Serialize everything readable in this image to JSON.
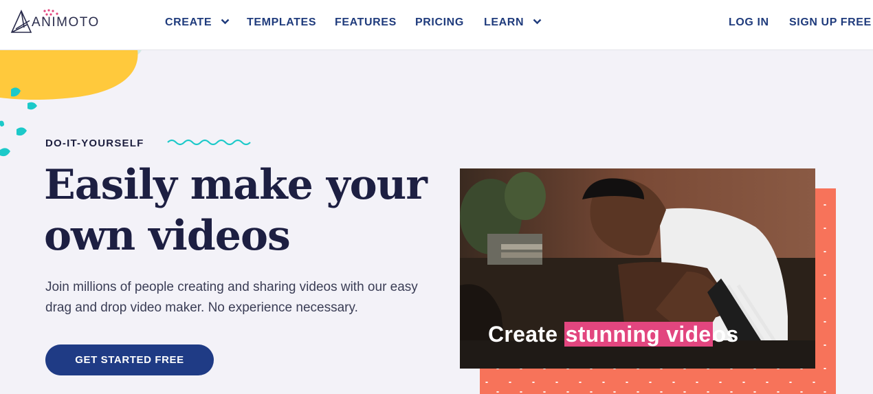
{
  "header": {
    "logo_text": "ANIMOTO",
    "nav": [
      {
        "label": "CREATE",
        "has_dropdown": true
      },
      {
        "label": "TEMPLATES",
        "has_dropdown": false
      },
      {
        "label": "FEATURES",
        "has_dropdown": false
      },
      {
        "label": "PRICING",
        "has_dropdown": false
      },
      {
        "label": "LEARN",
        "has_dropdown": true
      }
    ],
    "login": "LOG IN",
    "signup": "SIGN UP FREE"
  },
  "hero": {
    "eyebrow": "DO-IT-YOURSELF",
    "title": "Easily make your own videos",
    "subtitle": "Join millions of people creating and sharing videos with our easy drag and drop video maker. No experience necessary.",
    "cta": "GET STARTED FREE"
  },
  "video": {
    "caption_prefix": "Create ",
    "caption_highlight": "stunning vide",
    "caption_suffix": "os"
  },
  "colors": {
    "nav_text": "#1f3b7c",
    "heading": "#1d1f42",
    "cta_bg": "#1f3b85",
    "accent_yellow": "#ffc93c",
    "accent_teal": "#1cc9c9",
    "accent_coral": "#f7735a",
    "caption_highlight": "#e2467f",
    "page_bg": "#f3f2f8"
  },
  "icons": [
    "animoto-logo-icon",
    "chevron-down-icon",
    "wave-decoration-icon"
  ]
}
